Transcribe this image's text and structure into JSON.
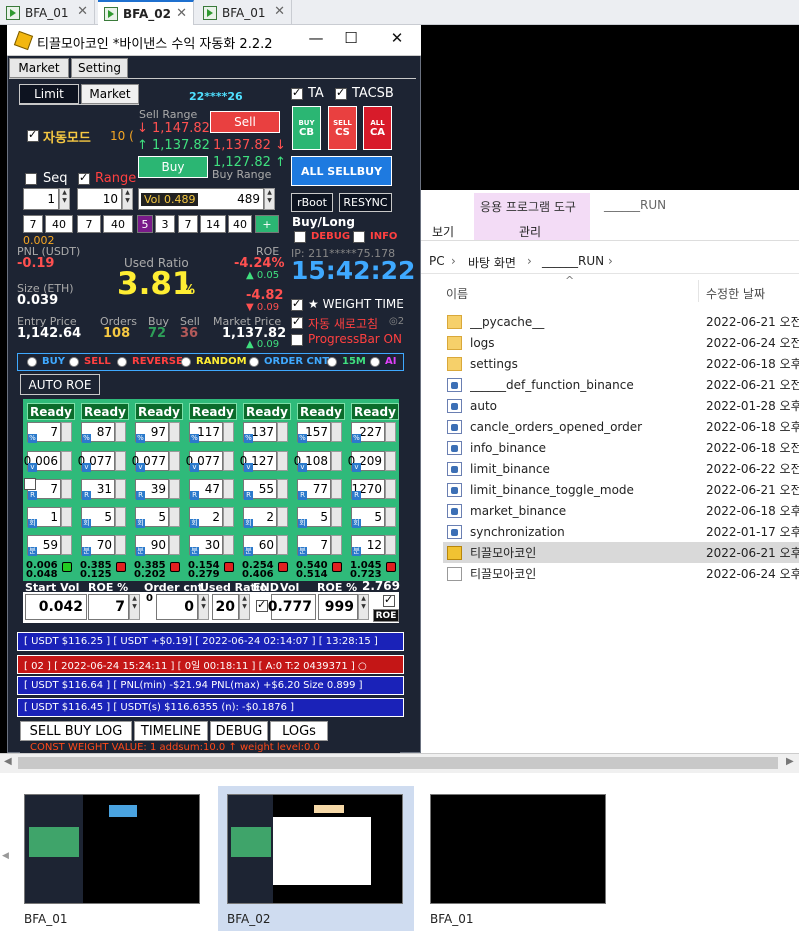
{
  "tabs": [
    {
      "label": "BFA_01"
    },
    {
      "label": "BFA_02"
    },
    {
      "label": "BFA_01"
    }
  ],
  "window": {
    "title": "티끌모아코인 *바이낸스 수익 자동화 2.2.2",
    "minimize": "—",
    "maximize": "☐",
    "close": "✕"
  },
  "top_tabs": {
    "market": "Market",
    "setting": "Setting"
  },
  "mode_tabs": {
    "limit": "Limit",
    "market": "Market"
  },
  "user_id": "22****26",
  "auto_mode": {
    "label": "자동모드",
    "value": "10 ("
  },
  "sell_range": {
    "label": "Sell Range",
    "high": "↓ 1,147.82",
    "low": "↑ 1,137.82"
  },
  "sell_button": "Sell",
  "buy_button": "Buy",
  "buy_range": {
    "label": "Buy Range",
    "high": "1,137.82 ↓",
    "low": "1,127.82 ↑"
  },
  "seq": {
    "label": "Seq",
    "value": "1"
  },
  "range": {
    "label": "Range",
    "value": "10"
  },
  "vol": {
    "label": "Vol 0.489",
    "value": "489"
  },
  "numrow": [
    "7",
    "40",
    "7",
    "40",
    "5",
    "3",
    "7",
    "14",
    "40",
    "+"
  ],
  "small_val": "0.002",
  "ta": {
    "ta_label": "TA",
    "tacsb_label": "TACSB"
  },
  "cs_buttons": [
    {
      "top": "BUY",
      "bottom": "CB"
    },
    {
      "top": "SELL",
      "bottom": "CS"
    },
    {
      "top": "ALL",
      "bottom": "CA"
    }
  ],
  "all_sellbuy": "ALL SELLBUY",
  "rboot": "rBoot",
  "resync": "RESYNC",
  "buylong": {
    "label": "Buy/Long",
    "debug": "DEBUG",
    "info": "INFO"
  },
  "ip": "IP: 211*****75.178",
  "clock": "15:42:22",
  "pnl": {
    "label": "PNL (USDT)",
    "value": "-0.19"
  },
  "used_ratio": {
    "label": "Used Ratio",
    "value": "3.81",
    "unit": "%"
  },
  "roe": {
    "label": "ROE",
    "value1": "-4.24%",
    "sub1": "▲ 0.05",
    "value2": "-4.82",
    "sub2": "▼ 0.09"
  },
  "size": {
    "label": "Size (ETH)",
    "value": "0.039"
  },
  "entry": {
    "label": "Entry Price",
    "value": "1,142.64"
  },
  "orders": {
    "label": "Orders",
    "value": "108"
  },
  "buy_count": {
    "label": "Buy",
    "value": "72"
  },
  "sell_count": {
    "label": "Sell",
    "value": "36"
  },
  "market_price": {
    "label": "Market Price",
    "value": "1,137.82",
    "sub": "▲ 0.09"
  },
  "weight_time": "★ WEIGHT TIME",
  "auto_refresh": {
    "label": "자동 새로고침",
    "sub": "◎2"
  },
  "progressbar": "ProgressBar ON",
  "radios": [
    "BUY",
    "SELL",
    "REVERSE",
    "RANDOM",
    "ORDER CNT",
    "15M",
    "AI"
  ],
  "auto_roe": "AUTO ROE",
  "ready_label": "Ready",
  "grid": {
    "row1": [
      "7",
      "87",
      "97",
      "117",
      "137",
      "157",
      "227"
    ],
    "row2": [
      "0.006",
      "0.077",
      "0.077",
      "0.077",
      "0.127",
      "0.108",
      "0.209"
    ],
    "row3": [
      "7",
      "31",
      "39",
      "47",
      "55",
      "77",
      "1270"
    ],
    "row4": [
      "1",
      "5",
      "5",
      "2",
      "2",
      "5",
      "5"
    ],
    "row5": [
      "59",
      "70",
      "90",
      "30",
      "60",
      "7",
      "12"
    ],
    "fx": [
      "0.006",
      "0.385",
      "0.385",
      "0.154",
      "0.254",
      "0.540",
      "1.045"
    ],
    "fy": [
      "0.048",
      "0.125",
      "0.202",
      "0.279",
      "0.406",
      "0.514",
      "0.723"
    ],
    "tags": {
      "r1": "%",
      "r2": "v",
      "r3": "R",
      "r4a": "1",
      "r4b": "회",
      "r5": "분"
    }
  },
  "bottom_labels": {
    "start_vol": "Start Vol",
    "roe_pct": "ROE %",
    "order_cnt": "Order cnt",
    "used_ratio": "Used Ratio",
    "end": "END",
    "vol": "Vol",
    "roe2": "ROE %",
    "val": "2.769",
    "roe_btn": "ROE",
    "zero": "0"
  },
  "bottom_inputs": {
    "start_vol": "0.042",
    "roe": "7",
    "order_cnt": "0",
    "used_ratio": "20",
    "vol": "0.777",
    "roe2": "999"
  },
  "logs": [
    "[ USDT $116.25 ] [ USDT +$0.19] [ 2022-06-24 02:14:07 ] [ 13:28:15 ]",
    "[  02 ] [ 2022-06-24 15:24:11 ] [ 0일 00:18:11 ] [ A:0 T:2 0439371 ]   ○",
    "[ USDT $116.64 ] [ PNL(min) -$21.94 PNL(max) +$6.20 Size 0.899 ]",
    "[ USDT $116.45 ] [ USDT(s) $116.6355 (n): -$0.1876 ]"
  ],
  "bottom_tabs": [
    "SELL BUY LOG",
    "TIMELINE",
    "DEBUG",
    "LOGs"
  ],
  "const_line": "CONST WEIGHT VALUE: 1 addsum:10.0 ↑ weight level:0.0",
  "explorer": {
    "ribbon_tool": "응용 프로그램 도구",
    "ribbon_run": "______RUN",
    "tab_view": "보기",
    "tab_manage": "관리",
    "address": [
      "PC",
      "바탕 화면",
      "______RUN"
    ],
    "col_name": "이름",
    "col_date": "수정한 날짜",
    "files": [
      {
        "name": "__pycache__",
        "date": "2022-06-21 오전",
        "type": "folder"
      },
      {
        "name": "logs",
        "date": "2022-06-24 오전",
        "type": "folder"
      },
      {
        "name": "settings",
        "date": "2022-06-18 오후",
        "type": "folder"
      },
      {
        "name": "______def_function_binance",
        "date": "2022-06-21 오전",
        "type": "py"
      },
      {
        "name": "auto",
        "date": "2022-01-28 오후",
        "type": "py"
      },
      {
        "name": "cancle_orders_opened_order",
        "date": "2022-06-18 오후",
        "type": "py"
      },
      {
        "name": "info_binance",
        "date": "2022-06-18 오전",
        "type": "py"
      },
      {
        "name": "limit_binance",
        "date": "2022-06-22 오전",
        "type": "py"
      },
      {
        "name": "limit_binance_toggle_mode",
        "date": "2022-06-21 오전",
        "type": "py"
      },
      {
        "name": "market_binance",
        "date": "2022-06-18 오후",
        "type": "py"
      },
      {
        "name": "synchronization",
        "date": "2022-01-17 오후",
        "type": "py"
      },
      {
        "name": "티끌모아코인",
        "date": "2022-06-21 오후",
        "type": "exe"
      },
      {
        "name": "티끌모아코인",
        "date": "2022-06-24 오후",
        "type": "lnk"
      }
    ]
  },
  "thumbs": [
    {
      "label": "BFA_01"
    },
    {
      "label": "BFA_02"
    },
    {
      "label": "BFA_01"
    }
  ]
}
